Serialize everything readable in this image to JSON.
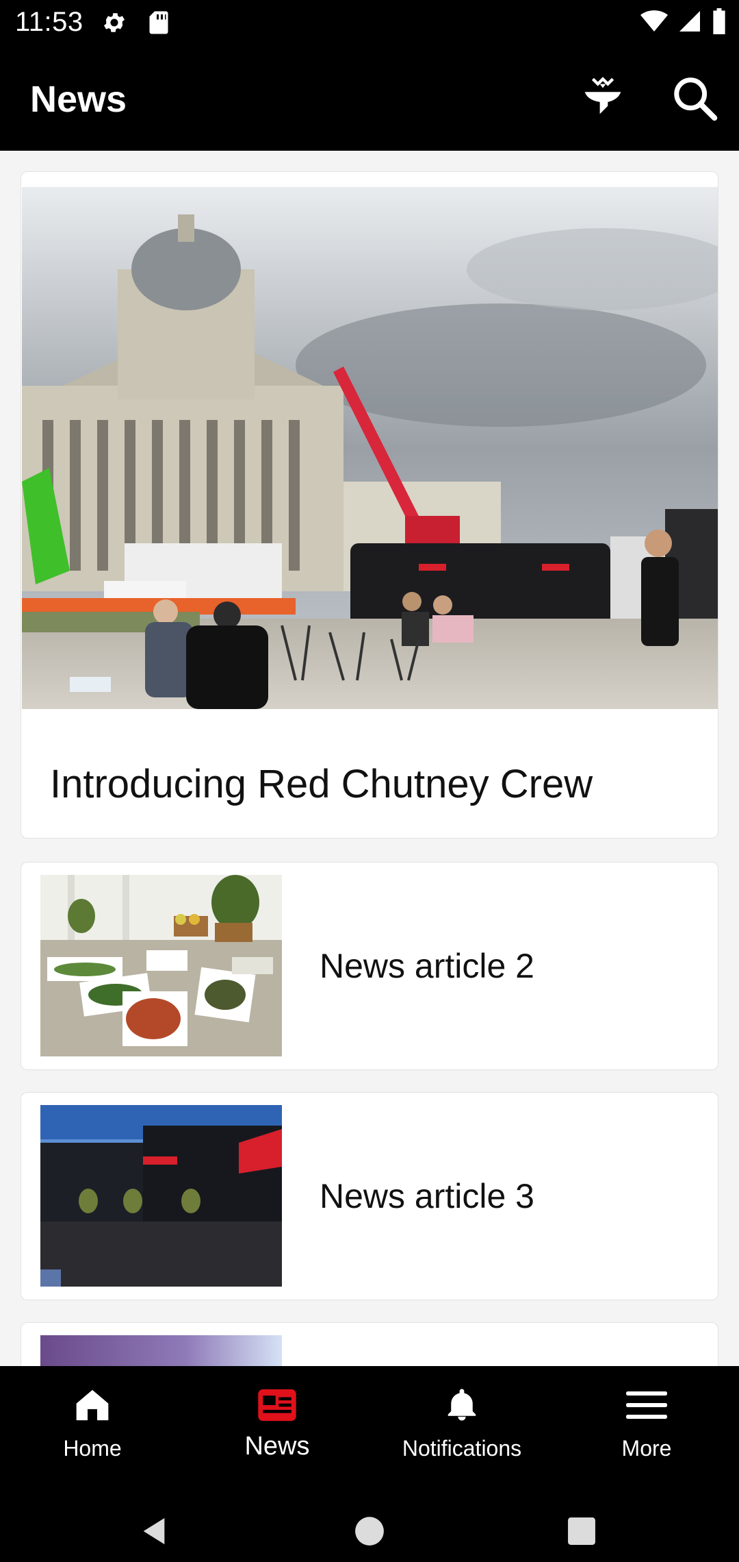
{
  "status_bar": {
    "time": "11:53",
    "icons": [
      "settings-icon",
      "sd-card-icon",
      "wifi-icon",
      "signal-icon",
      "battery-icon"
    ]
  },
  "app_bar": {
    "title": "News",
    "actions": [
      "filter-icon",
      "search-icon"
    ]
  },
  "featured": {
    "title": "Introducing Red Chutney Crew",
    "image": "photo of a domed neoclassical building with a red crane, a black food truck, and people sitting at outdoor tables"
  },
  "articles": [
    {
      "title": "News article 2",
      "image": "catering buffet table with salad and food dishes"
    },
    {
      "title": "News article 3",
      "image": "black Red Chutney trucks parked under a blue sky"
    }
  ],
  "bottom_nav": {
    "items": [
      {
        "label": "Home",
        "icon": "home-icon",
        "active": false
      },
      {
        "label": "News",
        "icon": "newspaper-icon",
        "active": true
      },
      {
        "label": "Notifications",
        "icon": "bell-icon",
        "active": false
      },
      {
        "label": "More",
        "icon": "menu-icon",
        "active": false
      }
    ]
  },
  "colors": {
    "accent": "#E0111B",
    "bar_background": "#000000",
    "content_background": "#F4F4F4"
  }
}
